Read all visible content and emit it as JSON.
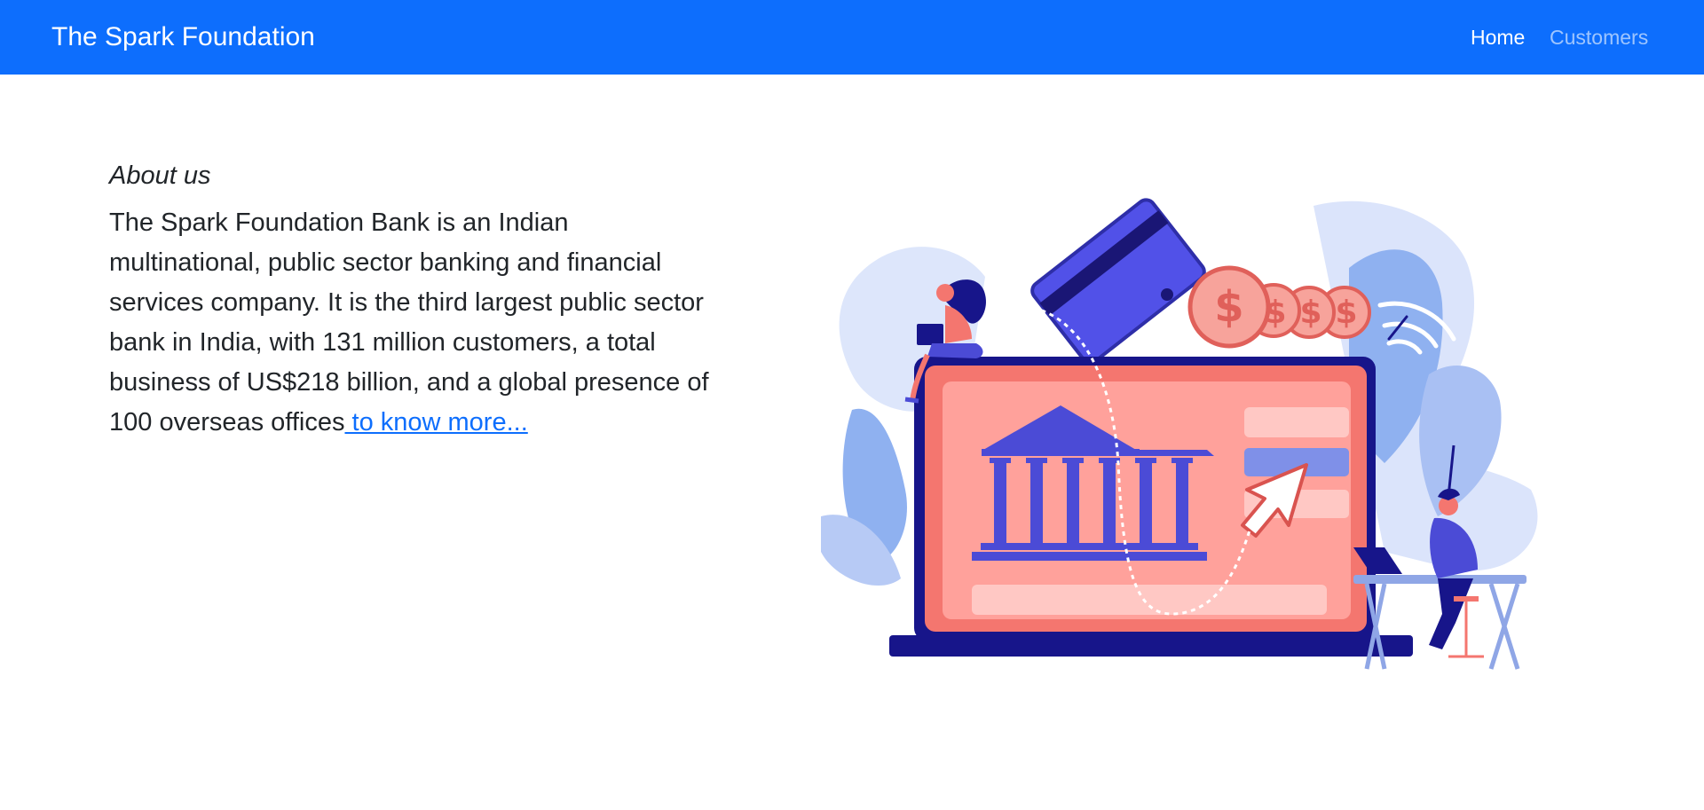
{
  "navbar": {
    "brand": "The Spark Foundation",
    "links": [
      {
        "label": "Home",
        "active": true
      },
      {
        "label": "Customers",
        "active": false
      }
    ],
    "background": "#0d6efd"
  },
  "about": {
    "heading": "About us",
    "body": "The Spark Foundation Bank is an Indian multinational, public sector banking and financial services company. It is the third largest public sector bank in India, with 131 million customers, a total business of US$218 billion, and a global presence of 100 overseas offices",
    "link_text": " to know more..."
  },
  "illustration": {
    "icon": "online-banking-illustration",
    "currency_symbol": "$",
    "colors": {
      "coral": "#f3756e",
      "indigo": "#4b4bd6",
      "navy": "#17158a",
      "lavender": "#c9d7f8"
    }
  }
}
